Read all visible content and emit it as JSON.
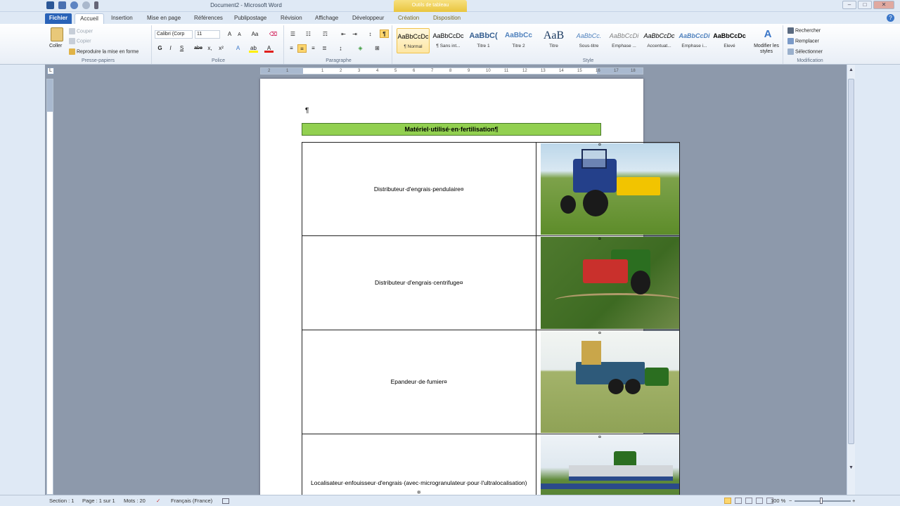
{
  "window": {
    "title": "Document2 - Microsoft Word",
    "context_tab": "Outils de tableau"
  },
  "tabs": [
    "Fichier",
    "Accueil",
    "Insertion",
    "Mise en page",
    "Références",
    "Publipostage",
    "Révision",
    "Affichage",
    "Développeur",
    "Création",
    "Disposition"
  ],
  "ribbon": {
    "clipboard": {
      "paste": "Coller",
      "cut": "Couper",
      "copy": "Copier",
      "format_painter": "Reproduire la mise en forme",
      "label": "Presse-papiers"
    },
    "font": {
      "name": "Calibri (Corp",
      "size": "11",
      "label": "Police",
      "bold": "G",
      "italic": "I",
      "underline": "S",
      "strike": "abe",
      "sub": "x,",
      "sup": "x²"
    },
    "paragraph": {
      "label": "Paragraphe",
      "pilcrow": "¶"
    },
    "styles": {
      "label": "Style",
      "items": [
        {
          "preview": "AaBbCcDc",
          "name": "¶ Normal"
        },
        {
          "preview": "AaBbCcDc",
          "name": "¶ Sans int..."
        },
        {
          "preview": "AaBbC(",
          "name": "Titre 1"
        },
        {
          "preview": "AaBbCc",
          "name": "Titre 2"
        },
        {
          "preview": "AaB",
          "name": "Titre"
        },
        {
          "preview": "AaBbCc.",
          "name": "Sous-titre"
        },
        {
          "preview": "AaBbCcDi",
          "name": "Emphase ..."
        },
        {
          "preview": "AaBbCcDc",
          "name": "Accentuat..."
        },
        {
          "preview": "AaBbCcDi",
          "name": "Emphase i..."
        },
        {
          "preview": "AaBbCcDc",
          "name": "Elevé"
        }
      ],
      "change_styles": "Modifier les styles"
    },
    "editing": {
      "label": "Modification",
      "find": "Rechercher",
      "replace": "Remplacer",
      "select": "Sélectionner"
    }
  },
  "ruler_ticks": [
    "2",
    "1",
    "1",
    "2",
    "3",
    "4",
    "5",
    "6",
    "7",
    "8",
    "9",
    "10",
    "11",
    "12",
    "13",
    "14",
    "15",
    "16",
    "17",
    "18"
  ],
  "document": {
    "pilcrow": "¶",
    "title": "Matériel·utilisé·en·fertilisation¶",
    "rows": [
      {
        "label": "Distributeur·d'engrais·pendulaire¤",
        "image": "tractor-with-pendular-spreader-photo"
      },
      {
        "label": "Distributeur·d'engrais·centrifuge¤",
        "image": "tractor-with-centrifugal-spreader-photo"
      },
      {
        "label": "Epandeur·de·fumier¤",
        "image": "manure-spreader-photo"
      },
      {
        "label": "Localisateur·enfouisseur·d'engrais·(avec·microgranulateur·pour·l'ultralocalisation)¤",
        "image": "fertilizer-placer-photo"
      }
    ],
    "cell_end": "¤"
  },
  "status": {
    "section": "Section : 1",
    "page": "Page : 1 sur 1",
    "words": "Mots : 20",
    "language": "Français (France)",
    "zoom": "100 %",
    "zoom_minus": "−",
    "zoom_plus": "+"
  }
}
